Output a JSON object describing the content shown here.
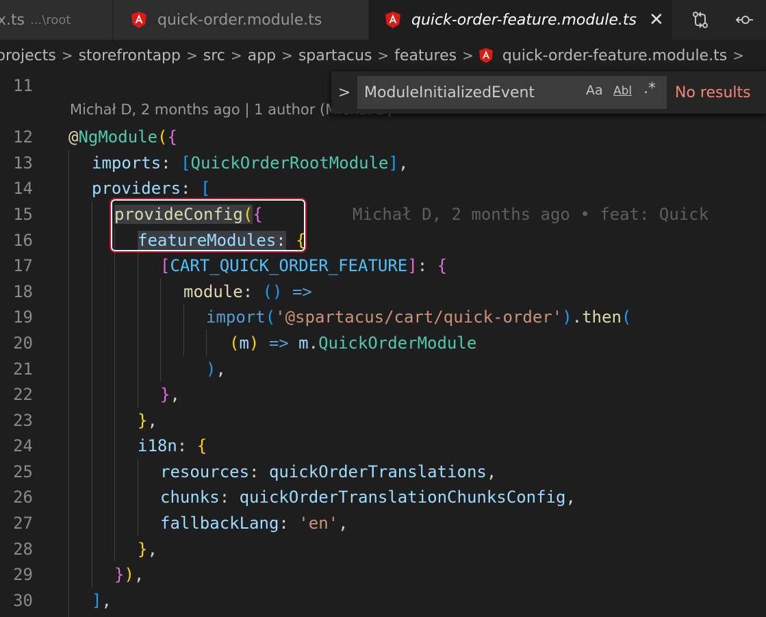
{
  "tabs": [
    {
      "name": "x.ts",
      "desc": "...\\root"
    },
    {
      "name": "quick-order.module.ts"
    },
    {
      "name": "quick-order-feature.module.ts",
      "close": "✕"
    }
  ],
  "breadcrumb": [
    "projects",
    "storefrontapp",
    "src",
    "app",
    "spartacus",
    "features",
    "quick-order-feature.module.ts"
  ],
  "find": {
    "value": "ModuleInitializedEvent",
    "opt_case": "Aa",
    "opt_word": "Abl",
    "opt_regex": ".*",
    "results": "No results"
  },
  "codelens": "Michał D, 2 months ago | 1 author (Michał D)",
  "blame": "Michał D, 2 months ago • feat: Quick",
  "lines": [
    {
      "n": "11",
      "t": ""
    },
    {
      "n": "12",
      "t": "@NgModule({"
    },
    {
      "n": "13",
      "t": "  imports: [QuickOrderRootModule],"
    },
    {
      "n": "14",
      "t": "  providers: ["
    },
    {
      "n": "15",
      "t": "    provideConfig({"
    },
    {
      "n": "16",
      "t": "      featureModules: {"
    },
    {
      "n": "17",
      "t": "        [CART_QUICK_ORDER_FEATURE]: {"
    },
    {
      "n": "18",
      "t": "          module: () =>"
    },
    {
      "n": "19",
      "t": "            import('@spartacus/cart/quick-order').then("
    },
    {
      "n": "20",
      "t": "              (m) => m.QuickOrderModule"
    },
    {
      "n": "21",
      "t": "            ),"
    },
    {
      "n": "22",
      "t": "        },"
    },
    {
      "n": "23",
      "t": "      },"
    },
    {
      "n": "24",
      "t": "      i18n: {"
    },
    {
      "n": "25",
      "t": "        resources: quickOrderTranslations,"
    },
    {
      "n": "26",
      "t": "        chunks: quickOrderTranslationChunksConfig,"
    },
    {
      "n": "27",
      "t": "        fallbackLang: 'en',"
    },
    {
      "n": "28",
      "t": "      },"
    },
    {
      "n": "29",
      "t": "    }),"
    },
    {
      "n": "30",
      "t": "  ],"
    }
  ],
  "colors": {
    "keyword": "#569cd6",
    "control": "#c586c0",
    "function": "#dcdcaa",
    "variable": "#9cdcfe",
    "constant": "#4fc1ff",
    "type": "#4ec9b0",
    "string": "#ce9178",
    "bracket1": "#ffd700",
    "bracket2": "#da70d6",
    "bracket3": "#179fff",
    "find_no_results": "#f48771",
    "callout_border": "#c8102e"
  }
}
